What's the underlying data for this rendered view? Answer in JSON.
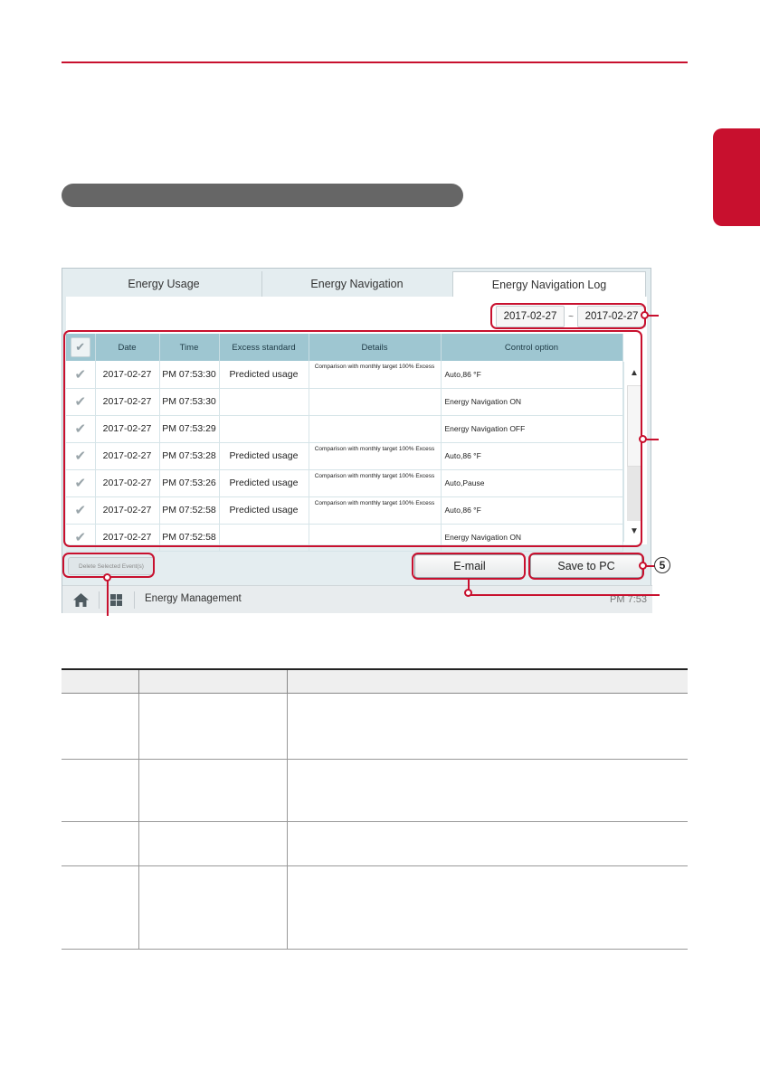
{
  "tabs": [
    "Energy Usage",
    "Energy Navigation",
    "Energy Navigation Log"
  ],
  "date_range": {
    "start": "2017-02-27",
    "separator": "~",
    "end": "2017-02-27"
  },
  "table": {
    "headers": [
      "Date",
      "Time",
      "Excess standard",
      "Details",
      "Control option"
    ],
    "rows": [
      {
        "date": "2017-02-27",
        "time": "PM 07:53:30",
        "standard": "Predicted usage",
        "details": "Comparison with monthly target 100% Excess",
        "option": "Auto,86 °F"
      },
      {
        "date": "2017-02-27",
        "time": "PM 07:53:30",
        "standard": "",
        "details": "",
        "option": "Energy Navigation ON"
      },
      {
        "date": "2017-02-27",
        "time": "PM 07:53:29",
        "standard": "",
        "details": "",
        "option": "Energy Navigation OFF"
      },
      {
        "date": "2017-02-27",
        "time": "PM 07:53:28",
        "standard": "Predicted usage",
        "details": "Comparison with monthly target 100% Excess",
        "option": "Auto,86 °F"
      },
      {
        "date": "2017-02-27",
        "time": "PM 07:53:26",
        "standard": "Predicted usage",
        "details": "Comparison with monthly target 100% Excess",
        "option": "Auto,Pause"
      },
      {
        "date": "2017-02-27",
        "time": "PM 07:52:58",
        "standard": "Predicted usage",
        "details": "Comparison with monthly target 100% Excess",
        "option": "Auto,86 °F"
      },
      {
        "date": "2017-02-27",
        "time": "PM 07:52:58",
        "standard": "",
        "details": "",
        "option": "Energy Navigation ON"
      }
    ]
  },
  "buttons": {
    "delete": "Delete Selected Event(s)",
    "email": "E-mail",
    "save": "Save to PC"
  },
  "bottom_bar": {
    "title": "Energy Management",
    "time": "PM 7:53"
  },
  "callout_number": "5",
  "colors": {
    "accent": "#c8102e",
    "table_header": "#9ec6d1"
  }
}
